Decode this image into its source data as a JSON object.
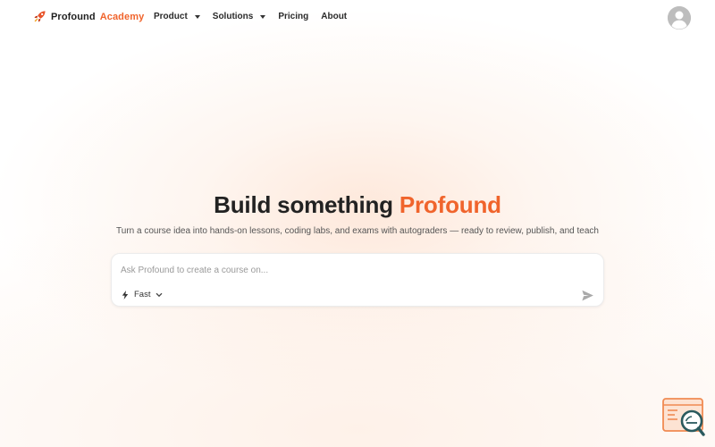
{
  "brand": {
    "name_part1": "Profound",
    "name_part2": "Academy",
    "icon": "rocket-icon"
  },
  "nav": {
    "items": [
      {
        "label": "Product",
        "has_dropdown": true
      },
      {
        "label": "Solutions",
        "has_dropdown": true
      },
      {
        "label": "Pricing",
        "has_dropdown": false
      },
      {
        "label": "About",
        "has_dropdown": false
      }
    ]
  },
  "avatar": {
    "icon": "user-avatar-icon"
  },
  "hero": {
    "title_main": "Build something",
    "title_accent": "Profound",
    "subtitle": "Turn a course idea into hands-on lessons, coding labs, and exams with autograders — ready to review, publish, and teach"
  },
  "prompt": {
    "placeholder": "Ask Profound to create a course on...",
    "value": "",
    "mode_label": "Fast",
    "mode_icon": "lightning-icon",
    "send_icon": "send-icon"
  },
  "colors": {
    "accent": "#f0642c",
    "text": "#222222",
    "muted": "#555555"
  }
}
